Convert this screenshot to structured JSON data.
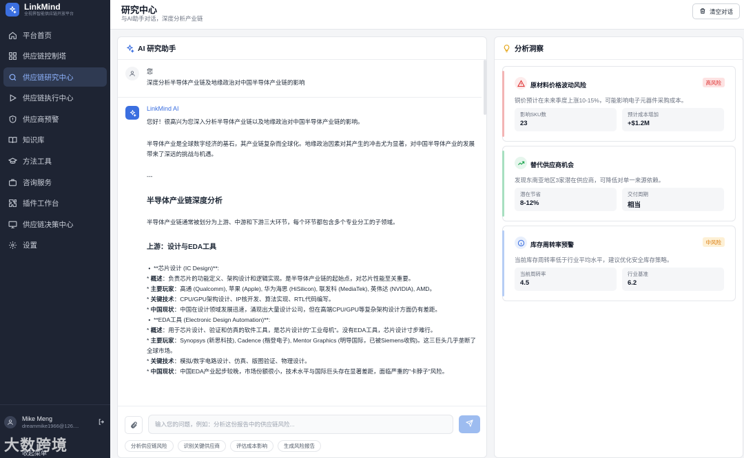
{
  "brand": {
    "name": "LinkMind",
    "subtitle": "全视界智能供应链开放平台"
  },
  "nav": [
    {
      "label": "平台首页",
      "icon": "home-icon",
      "active": false
    },
    {
      "label": "供应链控制塔",
      "icon": "grid-icon",
      "active": false
    },
    {
      "label": "供应链研究中心",
      "icon": "search-icon",
      "active": true
    },
    {
      "label": "供应链执行中心",
      "icon": "play-icon",
      "active": false
    },
    {
      "label": "供应商预警",
      "icon": "shield-alert-icon",
      "active": false
    },
    {
      "label": "知识库",
      "icon": "book-icon",
      "active": false
    },
    {
      "label": "方法工具",
      "icon": "graduation-cap-icon",
      "active": false
    },
    {
      "label": "咨询服务",
      "icon": "briefcase-icon",
      "active": false
    },
    {
      "label": "插件工作台",
      "icon": "puzzle-icon",
      "active": false
    },
    {
      "label": "供应链决策中心",
      "icon": "monitor-icon",
      "active": false
    },
    {
      "label": "设置",
      "icon": "gear-icon",
      "active": false
    }
  ],
  "user": {
    "name": "Mike Meng",
    "email": "dreammike1966@126...."
  },
  "collapse_label": "收起菜单",
  "watermark": "大数跨境",
  "header": {
    "title": "研究中心",
    "subtitle": "与AI助手对话，深度分析产业链",
    "clear_label": "清空对话"
  },
  "chat": {
    "title": "AI 研究助手",
    "user_name": "您",
    "user_text": "深度分析半导体产业链及地缘政治对中国半导体产业链的影响",
    "ai_name": "LinkMind AI",
    "greeting": "您好！很高兴为您深入分析半导体产业链以及地缘政治对中国半导体产业链的影响。",
    "intro": "半导体产业是全球数字经济的基石，其产业链复杂而全球化。地缘政治因素对其产生的冲击尤为显著，对中国半导体产业的发展带来了深远的挑战与机遇。",
    "divider": "---",
    "section_title": "半导体产业链深度分析",
    "section_intro": "半导体产业链通常被划分为上游、中游和下游三大环节，每个环节都包含多个专业分工的子领域。",
    "subsection_title": "上游：设计与EDA工具",
    "ic": {
      "head": "**芯片设计 (IC Design)**:",
      "overview_label": "概述",
      "overview": "负责芯片的功能定义、架构设计和逻辑实现。是半导体产业链的起始点，对芯片性能至关重要。",
      "players_label": "主要玩家",
      "players": "高通 (Qualcomm), 苹果 (Apple), 华为海思 (HiSilicon), 联发科 (MediaTek), 英伟达 (NVIDIA), AMD。",
      "tech_label": "关键技术",
      "tech": "CPU/GPU架构设计、IP核开发、算法实现、RTL代码编写。",
      "status_label": "中国现状",
      "status": "中国在设计领域发展迅速，涌现出大量设计公司，但在高端CPU/GPU等复杂架构设计方面仍有差距。"
    },
    "eda": {
      "head": "**EDA工具 (Electronic Design Automation)**:",
      "overview_label": "概述",
      "overview": "用于芯片设计、验证和仿真的软件工具，是芯片设计的\"工业母机\"。没有EDA工具，芯片设计寸步难行。",
      "players_label": "主要玩家",
      "players": "Synopsys (新思科技), Cadence (楷登电子), Mentor Graphics (明导国际，已被Siemens收购)。这三巨头几乎垄断了全球市场。",
      "tech_label": "关键技术",
      "tech": "模拟/数字电路设计、仿真、版图验证、物理设计。",
      "status_label": "中国现状",
      "status": "中国EDA产业起步较晚，市场份额很小，技术水平与国际巨头存在显著差距，面临严重的\"卡脖子\"风险。"
    },
    "input_placeholder": "输入您的问题，例如：分析这份报告中的供应链风险...",
    "chips": [
      "分析供应链风险",
      "识别关键供应商",
      "评估成本影响",
      "生成风险报告"
    ]
  },
  "insights": {
    "title": "分析洞察",
    "cards": [
      {
        "title": "原材料价格波动风险",
        "badge": "高风险",
        "desc": "铜价预计在未来季度上涨10-15%，可能影响电子元器件采购成本。",
        "metrics": [
          {
            "label": "影响SKU数",
            "value": "23"
          },
          {
            "label": "预计成本增加",
            "value": "+$1.2M"
          }
        ],
        "icon": "warning-triangle-icon",
        "accent": "#f3b4b4",
        "icon_color": "#dc2626",
        "icon_bg": "#fdecec",
        "badge_bg": "#fde2e2",
        "badge_color": "#dc2626"
      },
      {
        "title": "替代供应商机会",
        "badge": "",
        "desc": "发现东南亚地区3家潜在供应商，可降低对单一来源依赖。",
        "metrics": [
          {
            "label": "潜在节省",
            "value": "8-12%"
          },
          {
            "label": "交付周期",
            "value": "相当"
          }
        ],
        "icon": "trending-up-icon",
        "accent": "#a7dfc0",
        "icon_color": "#16a34a",
        "icon_bg": "#e6f6ed",
        "badge_bg": "",
        "badge_color": ""
      },
      {
        "title": "库存周转率预警",
        "badge": "中风险",
        "desc": "当前库存周转率低于行业平均水平，建议优化安全库存策略。",
        "metrics": [
          {
            "label": "当前周转率",
            "value": "4.5"
          },
          {
            "label": "行业基准",
            "value": "6.2"
          }
        ],
        "icon": "info-circle-icon",
        "accent": "#b6cdf5",
        "icon_color": "#3b6fe0",
        "icon_bg": "#e8effc",
        "badge_bg": "#fdf0d5",
        "badge_color": "#d97706"
      }
    ]
  }
}
